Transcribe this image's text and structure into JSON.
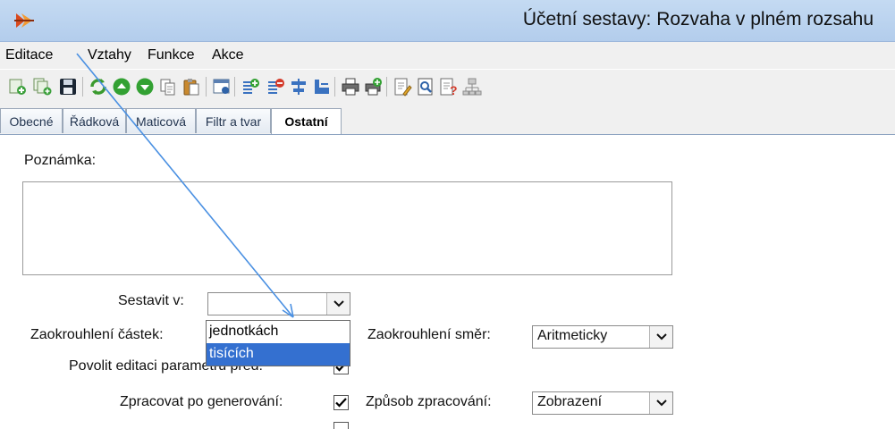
{
  "window": {
    "title": "Účetní sestavy: Rozvaha v plném rozsahu"
  },
  "menu": [
    "Editace",
    "Vztahy",
    "Funkce",
    "Akce"
  ],
  "toolbar": {
    "icons": [
      "new-row-icon",
      "copy-row-icon",
      "save-icon",
      "refresh-icon",
      "move-up-icon",
      "move-down-icon",
      "copy-icon",
      "paste-icon",
      "window-view-icon",
      "insert-row-icon",
      "delete-row-icon",
      "align-icon",
      "columns-icon",
      "print-icon",
      "print-settings-icon",
      "edit-document-icon",
      "preview-icon",
      "help-document-icon",
      "network-icon"
    ]
  },
  "tabs": [
    "Obecné",
    "Řádková",
    "Maticová",
    "Filtr a tvar",
    "Ostatní"
  ],
  "active_tab": "Ostatní",
  "form": {
    "note_label": "Poznámka:",
    "note_value": "",
    "build_in_label": "Sestavit v:",
    "build_in_value": "",
    "build_in_options": [
      "jednotkách",
      "tisících"
    ],
    "build_in_highlighted": "tisících",
    "rounding_amounts_label": "Zaokrouhlení částek:",
    "rounding_direction_label": "Zaokrouhlení směr:",
    "rounding_direction_value": "Aritmeticky",
    "allow_edit_label": "Povolit editaci parametru před:",
    "allow_edit_checked": true,
    "process_after_label": "Zpracovat po generování:",
    "process_after_checked": true,
    "processing_mode_label": "Způsob zpracování:",
    "processing_mode_value": "Zobrazení"
  },
  "colors": {
    "titlebar": "#b8d1ee",
    "selection": "#3470d0",
    "pointer": "#4a90e2"
  }
}
